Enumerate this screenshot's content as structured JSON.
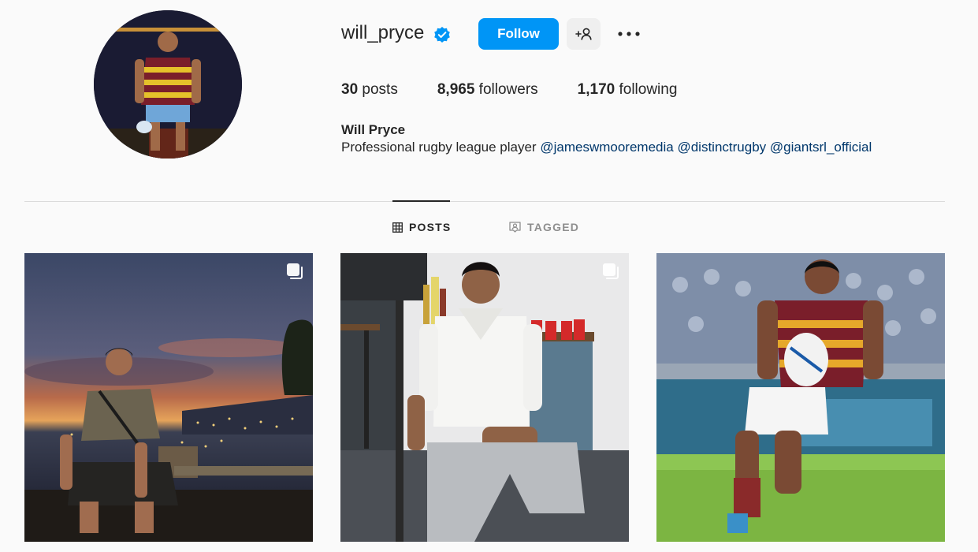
{
  "profile": {
    "username": "will_pryce",
    "verified": true,
    "follow_label": "Follow",
    "full_name": "Will Pryce",
    "bio_text": "Professional rugby league player",
    "mentions": [
      "@jameswmooremedia",
      "@distinctrugby",
      "@giantsrl_official"
    ]
  },
  "stats": {
    "posts_count": "30",
    "posts_label": "posts",
    "followers_count": "8,965",
    "followers_label": "followers",
    "following_count": "1,170",
    "following_label": "following"
  },
  "tabs": [
    {
      "label": "POSTS",
      "icon": "grid-icon",
      "active": true
    },
    {
      "label": "TAGGED",
      "icon": "tagged-icon",
      "active": false
    }
  ],
  "posts": [
    {
      "multi": true
    },
    {
      "multi": true
    },
    {
      "multi": false
    }
  ],
  "colors": {
    "accent": "#0095f6",
    "link": "#00376b",
    "verified": "#0095f6"
  }
}
